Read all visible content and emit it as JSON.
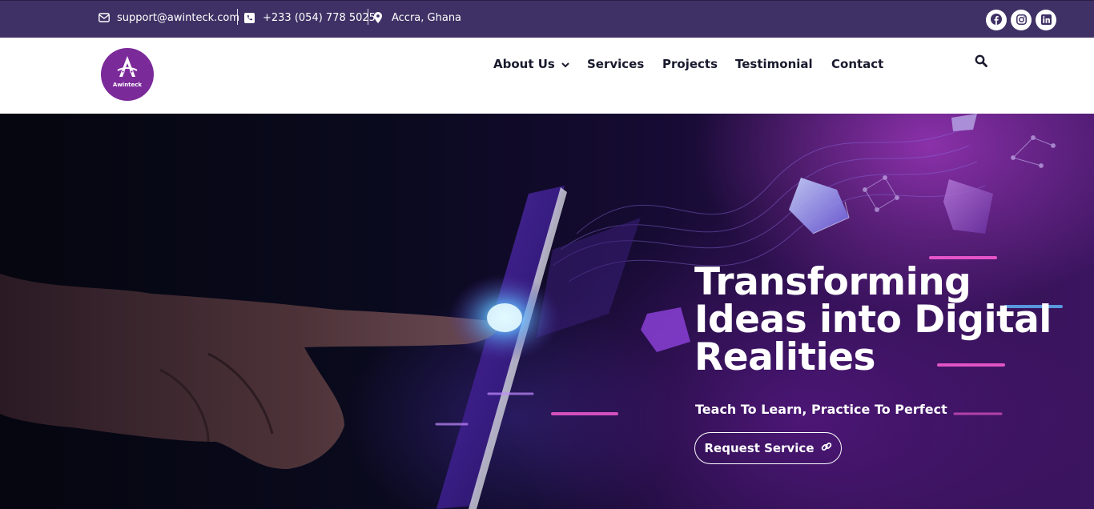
{
  "topbar": {
    "email": "support@awinteck.com",
    "phone": "+233 (054) 778 5025",
    "location": "Accra, Ghana",
    "bg_color": "#3f3165",
    "social": [
      "facebook-icon",
      "instagram-icon",
      "linkedin-icon"
    ]
  },
  "nav": {
    "logo_text": "Awinteck",
    "items": [
      {
        "label": "About Us",
        "has_dropdown": true
      },
      {
        "label": "Services"
      },
      {
        "label": "Projects"
      },
      {
        "label": "Testimonial"
      },
      {
        "label": "Contact"
      }
    ],
    "search_icon": "search-icon"
  },
  "hero": {
    "title": "Transforming Ideas into Digital Realities",
    "subtitle": "Teach To Learn, Practice To Perfect",
    "cta_label": "Request Service",
    "accent_color": "#7b2a9a"
  }
}
